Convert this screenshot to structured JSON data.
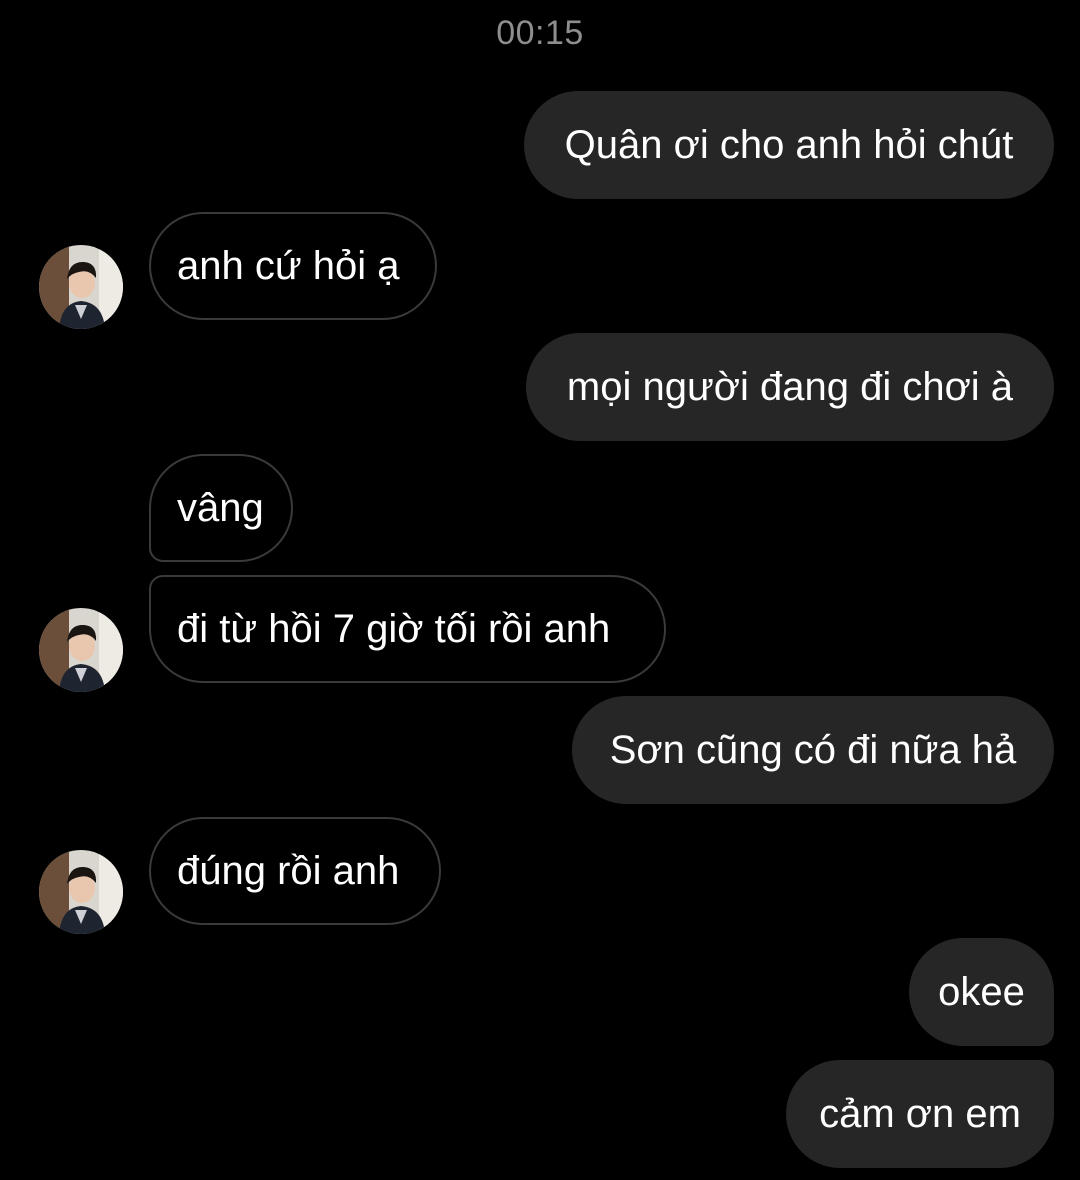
{
  "header": {
    "time": "00:15"
  },
  "colors": {
    "background": "#000000",
    "outgoing_bubble": "#262626",
    "incoming_border": "#3a3a3a",
    "timestamp": "#8e8e8e",
    "text": "#ffffff"
  },
  "messages": [
    {
      "direction": "outgoing",
      "text": "Quân ơi cho anh hỏi chút"
    },
    {
      "direction": "incoming",
      "text": "anh cứ hỏi ạ",
      "avatar": "contact-avatar"
    },
    {
      "direction": "outgoing",
      "text": "mọi người đang đi chơi à"
    },
    {
      "direction": "incoming",
      "text": "vâng"
    },
    {
      "direction": "incoming",
      "text": "đi từ hồi 7 giờ tối rồi anh",
      "avatar": "contact-avatar"
    },
    {
      "direction": "outgoing",
      "text": "Sơn cũng có đi nữa hả"
    },
    {
      "direction": "incoming",
      "text": "đúng rồi anh",
      "avatar": "contact-avatar"
    },
    {
      "direction": "outgoing",
      "text": "okee"
    },
    {
      "direction": "outgoing",
      "text": "cảm ơn em"
    }
  ]
}
